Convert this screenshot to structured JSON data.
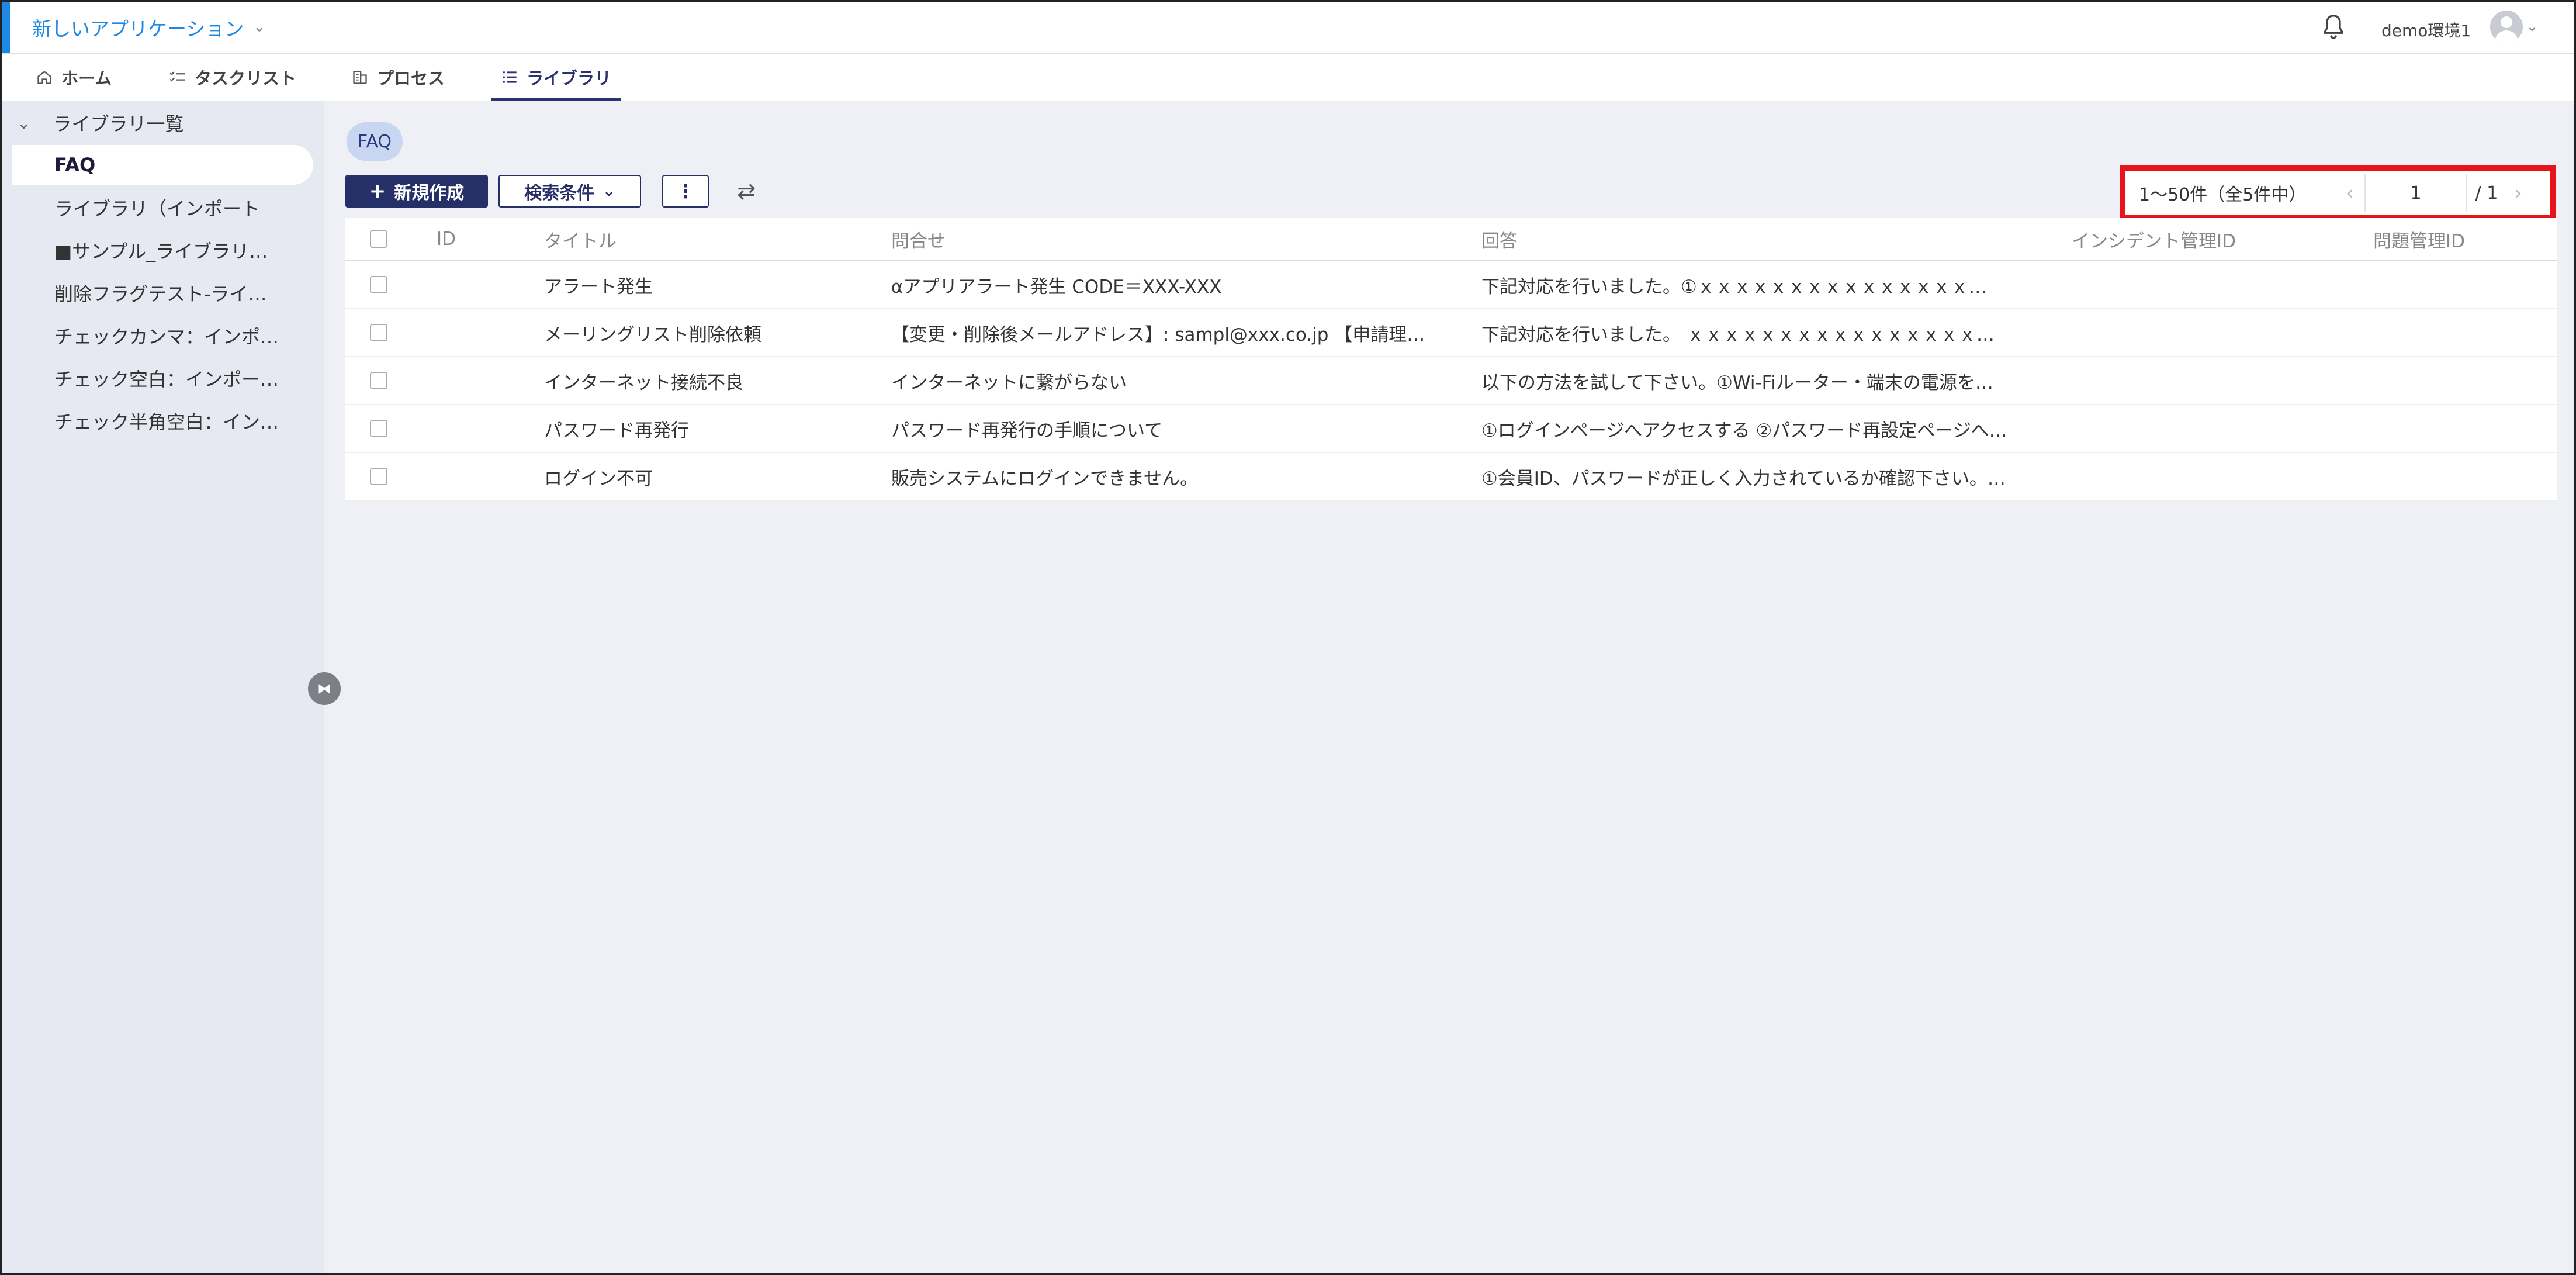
{
  "header": {
    "app_title": "新しいアプリケーション",
    "environment": "demo環境1"
  },
  "tabs": [
    {
      "label": "ホーム",
      "icon": "home-icon"
    },
    {
      "label": "タスクリスト",
      "icon": "checklist-icon"
    },
    {
      "label": "プロセス",
      "icon": "building-icon"
    },
    {
      "label": "ライブラリ",
      "icon": "list-icon",
      "active": true
    }
  ],
  "sidebar": {
    "root_label": "ライブラリ一覧",
    "items": [
      {
        "label": "FAQ",
        "active": true
      },
      {
        "label": "ライブラリ（インポート"
      },
      {
        "label": "■サンプル_ライブラリ…"
      },
      {
        "label": "削除フラグテスト-ライ…"
      },
      {
        "label": "チェックカンマ：インポ…"
      },
      {
        "label": "チェック空白：インポー…"
      },
      {
        "label": "チェック半角空白：イン…"
      }
    ]
  },
  "main": {
    "chip_label": "FAQ",
    "new_button": "新規作成",
    "filter_button": "検索条件"
  },
  "pagination": {
    "range_text": "1〜50件（全5件中）",
    "current_page": "1",
    "total_text": "/ 1"
  },
  "table": {
    "headers": {
      "id": "ID",
      "title": "タイトル",
      "inquiry": "問合せ",
      "answer": "回答",
      "incident_id": "インシデント管理ID",
      "problem_id": "問題管理ID"
    },
    "rows": [
      {
        "id": "",
        "title": "アラート発生",
        "inquiry": "αアプリアラート発生 CODE＝XXX-XXX",
        "answer": "下記対応を行いました。①ｘｘｘｘｘｘｘｘｘｘｘｘｘｘｘ…",
        "incident_id": "",
        "problem_id": ""
      },
      {
        "id": "",
        "title": "メーリングリスト削除依頼",
        "inquiry": "【変更・削除後メールアドレス】: sampl@xxx.co.jp 【申請理…",
        "answer": "下記対応を行いました。 ｘｘｘｘｘｘｘｘｘｘｘｘｘｘｘｘ…",
        "incident_id": "",
        "problem_id": ""
      },
      {
        "id": "",
        "title": "インターネット接続不良",
        "inquiry": "インターネットに繋がらない",
        "answer": "以下の方法を試して下さい。①Wi-Fiルーター・端末の電源を…",
        "incident_id": "",
        "problem_id": ""
      },
      {
        "id": "",
        "title": "パスワード再発行",
        "inquiry": "パスワード再発行の手順について",
        "answer": "①ログインページへアクセスする ②パスワード再設定ページへ…",
        "incident_id": "",
        "problem_id": ""
      },
      {
        "id": "",
        "title": "ログイン不可",
        "inquiry": "販売システムにログインできません。",
        "answer": "①会員ID、パスワードが正しく入力されているか確認下さい。…",
        "incident_id": "",
        "problem_id": ""
      }
    ]
  },
  "colors": {
    "accent": "#1e88e5",
    "primary": "#263068",
    "highlight": "#e8141b"
  }
}
